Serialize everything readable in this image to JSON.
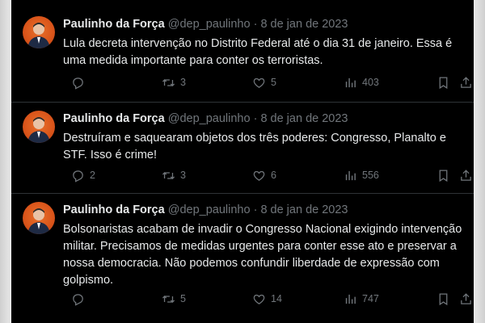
{
  "tweets": [
    {
      "name": "Paulinho da Força",
      "handle": "@dep_paulinho",
      "separator": "·",
      "date": "8 de jan de 2023",
      "text": "Lula decreta intervenção no Distrito Federal até o dia 31 de janeiro. Essa é uma medida importante para conter os terroristas.",
      "replies": "",
      "retweets": "3",
      "likes": "5",
      "views": "403"
    },
    {
      "name": "Paulinho da Força",
      "handle": "@dep_paulinho",
      "separator": "·",
      "date": "8 de jan de 2023",
      "text": "Destruíram e saquearam objetos dos três poderes: Congresso, Planalto e STF. Isso é crime!",
      "replies": "2",
      "retweets": "3",
      "likes": "6",
      "views": "556"
    },
    {
      "name": "Paulinho da Força",
      "handle": "@dep_paulinho",
      "separator": "·",
      "date": "8 de jan de 2023",
      "text": "Bolsonaristas acabam de invadir o Congresso Nacional exigindo intervenção militar. Precisamos de medidas urgentes para conter esse ato e preservar a nossa democracia. Não podemos confundir liberdade de expressão com golpismo.",
      "replies": "",
      "retweets": "5",
      "likes": "14",
      "views": "747"
    }
  ],
  "icons": {
    "reply": "reply-icon",
    "retweet": "retweet-icon",
    "like": "heart-icon",
    "views": "views-chart-icon",
    "bookmark": "bookmark-icon",
    "share": "share-icon"
  },
  "colors": {
    "background": "#000000",
    "text": "#e7e9ea",
    "muted": "#71767b",
    "divider": "#2f3336",
    "avatar": "#d9541a"
  }
}
